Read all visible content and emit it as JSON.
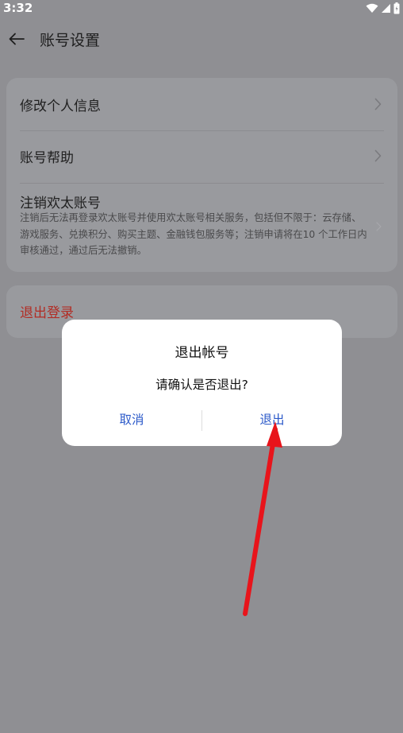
{
  "status_bar": {
    "time": "3:32"
  },
  "header": {
    "title": "账号设置"
  },
  "settings": {
    "items": [
      {
        "label": "修改个人信息"
      },
      {
        "label": "账号帮助"
      },
      {
        "label": "注销欢太账号",
        "description": "注销后无法再登录欢太账号并使用欢太账号相关服务，包括但不限于：云存储、游戏服务、兑换积分、购买主题、金融钱包服务等；注销申请将在10 个工作日内审核通过，通过后无法撤销。"
      }
    ],
    "logout": {
      "label": "退出登录",
      "color": "#b22c24"
    }
  },
  "dialog": {
    "title": "退出帐号",
    "message": "请确认是否退出?",
    "cancel_label": "取消",
    "confirm_label": "退出",
    "button_color": "#2b59c9"
  },
  "annotation": {
    "color": "#e8141b"
  }
}
